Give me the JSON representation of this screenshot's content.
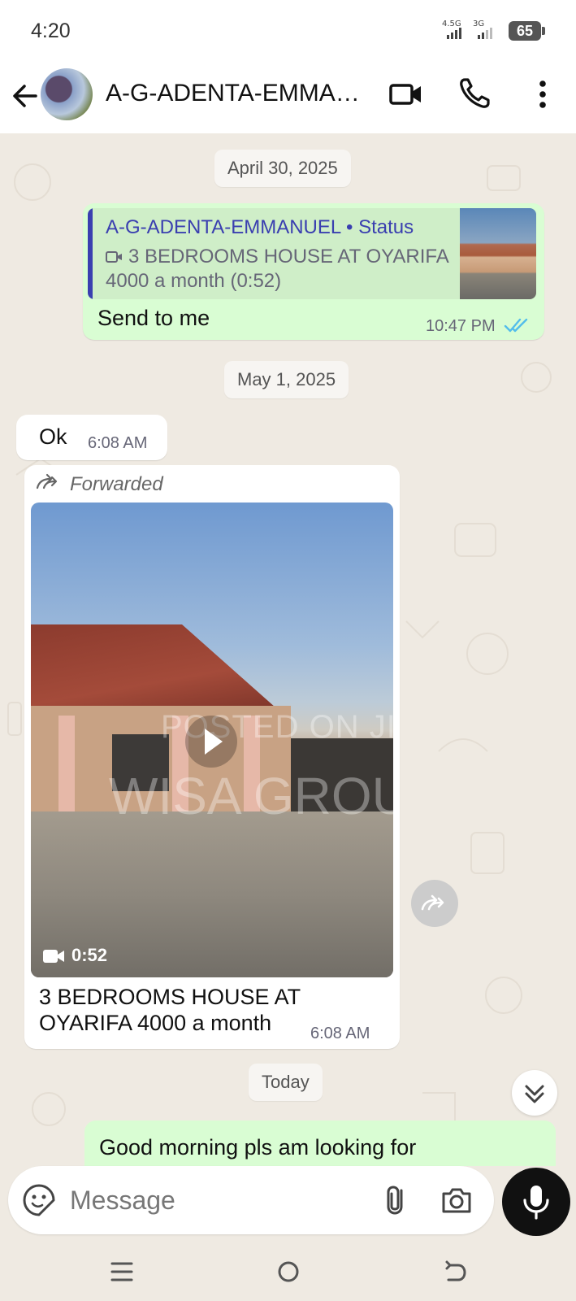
{
  "status_bar": {
    "time": "4:20",
    "network1": "4.5G",
    "network2": "3G",
    "battery": "65"
  },
  "header": {
    "contact_name": "A-G-ADENTA-EMMAN…",
    "back_icon": "arrow-left-icon",
    "video_call_icon": "video-camera-icon",
    "voice_call_icon": "phone-icon",
    "menu_icon": "more-vertical-icon"
  },
  "chat": {
    "dates": [
      "April 30, 2025",
      "May 1, 2025",
      "Today"
    ],
    "messages": [
      {
        "direction": "outgoing",
        "quote": {
          "author": "A-G-ADENTA-EMMANUEL • Status",
          "line1": "3 BEDROOMS HOUSE AT OYARIFA",
          "line2": "4000 a month (0:52)"
        },
        "text": "Send to me",
        "time": "10:47 PM",
        "status": "read"
      },
      {
        "direction": "incoming",
        "text": "Ok",
        "time": "6:08 AM"
      },
      {
        "direction": "incoming",
        "forwarded_label": "Forwarded",
        "video_duration": "0:52",
        "watermark_line1": "POSTED ON JIJI",
        "watermark_line2": "WISA GROUP",
        "caption": "3 BEDROOMS HOUSE AT OYARIFA 4000 a month",
        "time": "6:08 AM"
      },
      {
        "direction": "outgoing",
        "text": "Good morning pls am looking for"
      }
    ]
  },
  "composer": {
    "placeholder": "Message",
    "value": ""
  },
  "colors": {
    "outgoing_bubble": "#d9fdd3",
    "incoming_bubble": "#ffffff",
    "chat_background": "#efeae2",
    "quote_accent": "#3a3fb0",
    "read_ticks": "#53bdeb"
  }
}
